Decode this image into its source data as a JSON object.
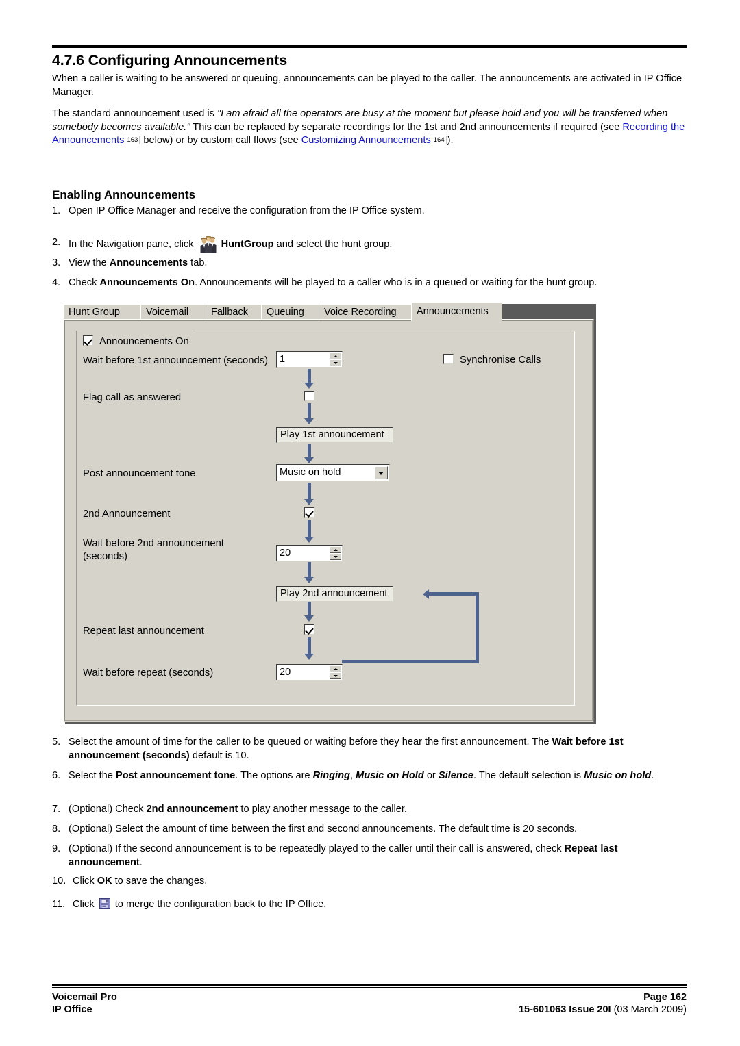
{
  "document": {
    "section_number_title": "4.7.6 Configuring Announcements",
    "paragraph_1": "When a caller is waiting to be answered or queuing, announcements can be played to the caller. The announcements are activated in IP Office Manager.",
    "paragraph_2": {
      "lead": "The standard announcement used is ",
      "quoted_italic": "\"I am afraid all the operators are busy at the moment but please hold and you will be transferred when somebody becomes available.\"",
      "mid": " This can be replaced by separate recordings for the 1st and 2nd announcements if required (see ",
      "link_1": "Recording the Announcements",
      "pageref_1": "163",
      "mid2": " below) or by custom call flows (see ",
      "link_2": "Customizing Announcements",
      "pageref_2": "164",
      "tail": ")."
    },
    "subheading": "Enabling Announcements",
    "steps_before_figure": [
      {
        "num": "1.",
        "text": "Open IP Office Manager and receive the configuration from the IP Office system."
      },
      {
        "num": "2.",
        "text_before_icon": "In the Navigation pane, click ",
        "icon": "huntgroup-icon",
        "bold_after_icon": "HuntGroup",
        "text_after": " and select the hunt group."
      },
      {
        "num": "3.",
        "text_before_bold": "View the ",
        "bold": "Announcements",
        "text_after": " tab."
      },
      {
        "num": "4.",
        "text_before_bold": "Check ",
        "bold": "Announcements On",
        "text_after": ". Announcements will be played to a caller who is in a queued or waiting for the hunt group."
      }
    ],
    "steps_after_figure": [
      {
        "num": "5.",
        "a": "Select the amount of time for the caller to be queued or waiting before they hear the first announcement. The ",
        "b_bold": "Wait before 1st announcement (seconds)",
        "c": " default is 10."
      },
      {
        "num": "6.",
        "a": "Select the ",
        "b_bold": "Post announcement tone",
        "c": ". The options are ",
        "opt1": "Ringing",
        "c2": ", ",
        "opt2": "Music on Hold",
        "c3": " or ",
        "opt3": "Silence",
        "c4": ". The default selection is ",
        "opt4": "Music on hold",
        "c5": "."
      },
      {
        "num": "7.",
        "a": "(Optional) Check ",
        "b_bold": "2nd announcement",
        "c": " to play another message to the caller."
      },
      {
        "num": "8.",
        "a": "(Optional) Select the amount of time between the first and second announcements. The default time is 20 seconds."
      },
      {
        "num": "9.",
        "a": "(Optional) If the second announcement is to be repeatedly played to the caller until their call is answered, check ",
        "b_bold": "Repeat last announcement",
        "c": "."
      },
      {
        "num": "10.",
        "a": "Click ",
        "b_bold": "OK",
        "c": " to save the changes."
      },
      {
        "num": "11.",
        "a": "Click ",
        "icon": "save-disk-icon",
        "c": " to merge the configuration back to the IP Office."
      }
    ]
  },
  "dialog": {
    "tabs": [
      {
        "label": "Hunt Group",
        "active": false
      },
      {
        "label": "Voicemail",
        "active": false
      },
      {
        "label": "Fallback",
        "active": false
      },
      {
        "label": "Queuing",
        "active": false
      },
      {
        "label": "Voice Recording",
        "active": false
      },
      {
        "label": "Announcements",
        "active": true
      }
    ],
    "groupbox": {
      "legend_label": "Announcements On",
      "legend_checked": true
    },
    "fields": {
      "wait_1st_label": "Wait before 1st announcement (seconds)",
      "wait_1st_value": "1",
      "synchronise_label": "Synchronise Calls",
      "synchronise_checked": false,
      "flag_answered_label": "Flag call as answered",
      "flag_answered_checked": false,
      "play_1st_label": "Play 1st announcement",
      "post_tone_label": "Post announcement tone",
      "post_tone_value": "Music on hold",
      "second_announcement_label": "2nd Announcement",
      "second_announcement_checked": true,
      "wait_2nd_label": "Wait before 2nd announcement (seconds)",
      "wait_2nd_value": "20",
      "play_2nd_label": "Play 2nd announcement",
      "repeat_last_label": "Repeat last announcement",
      "repeat_last_checked": true,
      "wait_repeat_label": "Wait before repeat (seconds)",
      "wait_repeat_value": "20"
    }
  },
  "footer": {
    "left_line1": "Voicemail Pro",
    "left_line2": "IP Office",
    "right_line1": "Page 162",
    "right_line2_bold": "15-601063 Issue 20I",
    "right_line2_rest": " (03 March 2009)"
  },
  "colors": {
    "link": "#1414cf",
    "dialog_face": "#d6d3cb",
    "flow_arrow": "#4d628e",
    "flow_node_face": "#ecebe3"
  }
}
